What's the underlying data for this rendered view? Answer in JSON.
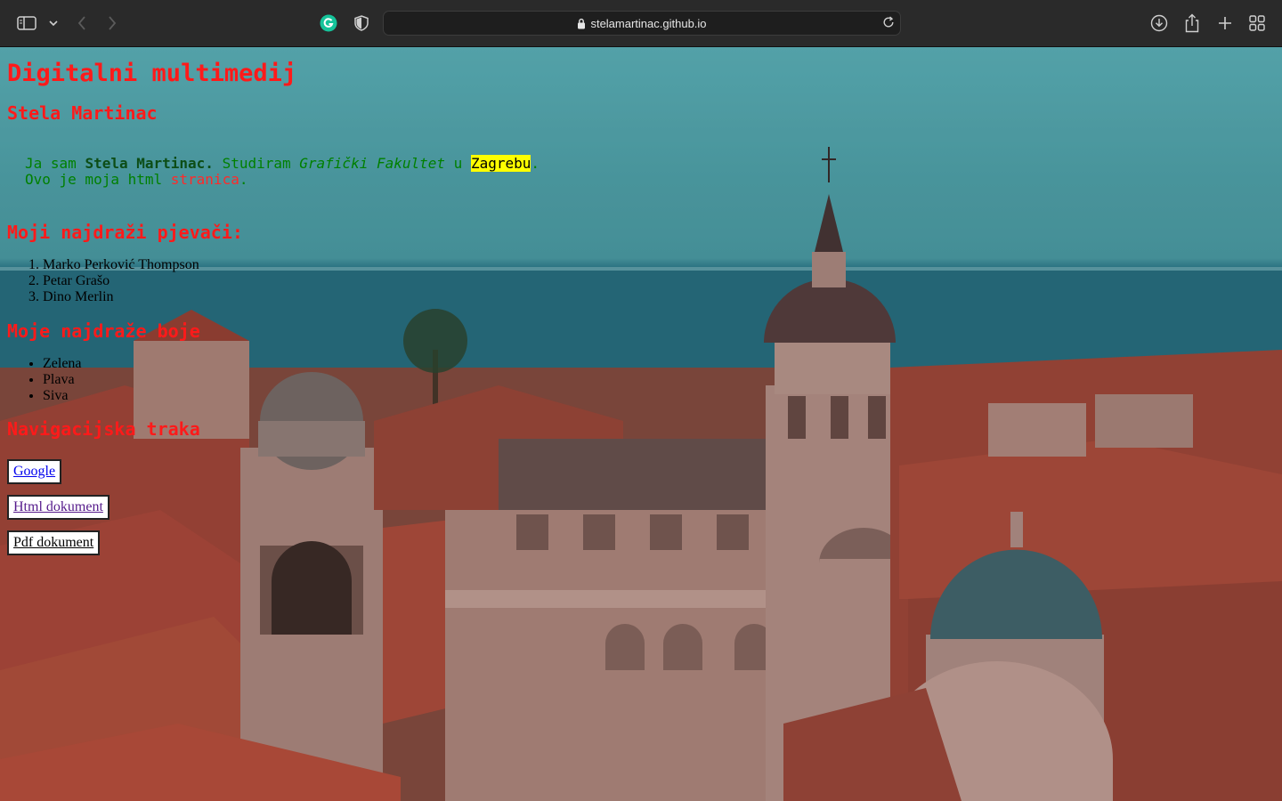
{
  "browser": {
    "url": "stelamartinac.github.io"
  },
  "page": {
    "title": "Digitalni multimedij",
    "author": "Stela Martinac",
    "intro": {
      "p1": "Ja sam ",
      "name": "Stela Martinac.",
      "p2": " Studiram ",
      "faculty": "Grafički Fakultet",
      "p3": " u ",
      "city": "Zagrebu",
      "p4": ".",
      "line2a": "Ovo je moja html ",
      "line2b": "stranica",
      "line2c": "."
    },
    "singers_heading": "Moji najdraži pjevači:",
    "singers": [
      "Marko Perković Thompson",
      "Petar Grašo",
      "Dino Merlin"
    ],
    "colors_heading": "Moje najdraže boje",
    "colors": [
      "Zelena",
      "Plava",
      "Siva"
    ],
    "nav_heading": "Navigacijska traka",
    "nav_links": [
      "Google",
      "Html dokument",
      "Pdf dokument"
    ]
  },
  "theme": {
    "heading_color": "#ff1a1a",
    "text_green": "#008000",
    "highlight": "#ffff00"
  }
}
